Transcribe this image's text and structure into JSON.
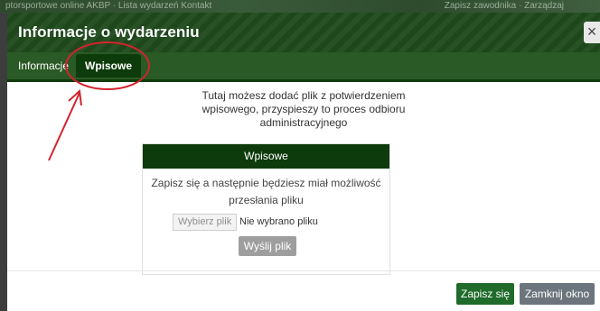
{
  "background": {
    "left_text": "ptorsportowe online AKBP · Lista wydarzeń  Kontakt",
    "right_text": "Zapisz zawodnika · Zarządzaj"
  },
  "modal": {
    "title": "Informacje o wydarzeniu",
    "close_label": "×"
  },
  "tabs": [
    {
      "label": "Informacje",
      "active": false
    },
    {
      "label": "Wpisowe",
      "active": true
    }
  ],
  "intro": {
    "line1": "Tutaj możesz dodać plik z potwierdzeniem",
    "line2": "wpisowego, przyspieszy to proces odbioru",
    "line3": "administracyjnego"
  },
  "panel": {
    "header": "Wpisowe",
    "text_line1": "Zapisz się a następnie będziesz miał możliwość",
    "text_line2": "przesłania pliku",
    "choose_file_label": "Wybierz plik",
    "no_file_label": "Nie wybrano pliku",
    "send_label": "Wyślij plik"
  },
  "footer": {
    "save_label": "Zapisz się",
    "close_label": "Zamknij okno"
  },
  "colors": {
    "header_green": "#1f4a1c",
    "tab_active": "#0e3b0b",
    "save_button": "#1f6b2a",
    "close_button": "#6c757d",
    "annotation_red": "#d3232e"
  }
}
